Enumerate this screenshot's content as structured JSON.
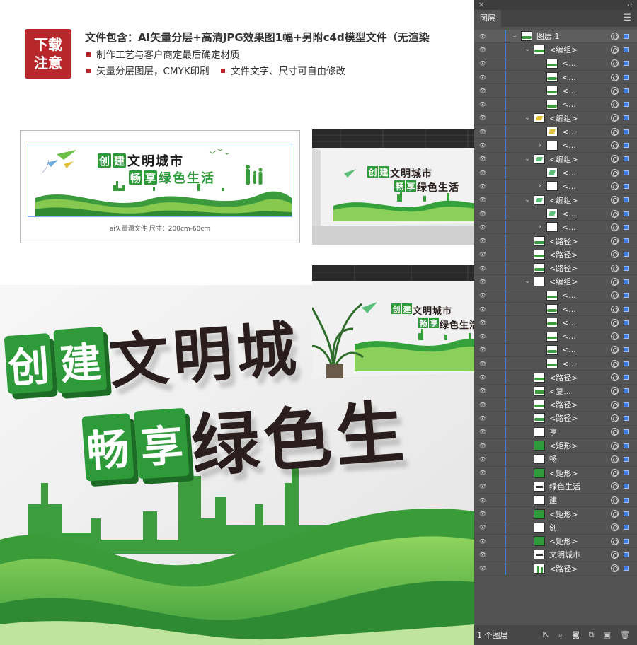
{
  "badge": {
    "line1": "下载",
    "line2": "注意"
  },
  "info": {
    "line1": "文件包含：AI矢量分层+高清JPG效果图1幅+另附c4d模型文件（无渲染",
    "bullet1": "制作工艺与客户商定最后确定材质",
    "bullet2": "矢量分层图层，CMYK印刷",
    "bullet3": "文件文字、尺寸可自由修改"
  },
  "artwork": {
    "chars_line1": [
      "创",
      "建",
      "文",
      "明",
      "城",
      "市"
    ],
    "chars_line2": [
      "畅",
      "享",
      "绿",
      "色",
      "生",
      "活"
    ],
    "caption": "ai矢量源文件    尺寸：200cm-60cm"
  },
  "colors": {
    "brand_red": "#b8272c",
    "green": "#2e9a3a",
    "light_green": "#7cc44a",
    "panel_bg": "#535353",
    "select_blue": "#3b7de0"
  },
  "layers_panel": {
    "tab": "图层",
    "footer": "1 个图层",
    "rows": [
      {
        "name": "图层 1",
        "indent": 0,
        "twirl": "open",
        "eye": true,
        "thumb": "scene"
      },
      {
        "name": "<编组>",
        "indent": 1,
        "twirl": "open",
        "eye": true,
        "thumb": "wave"
      },
      {
        "name": "<...",
        "indent": 2,
        "twirl": "",
        "eye": true,
        "thumb": "wave"
      },
      {
        "name": "<...",
        "indent": 2,
        "twirl": "",
        "eye": true,
        "thumb": "wave"
      },
      {
        "name": "<...",
        "indent": 2,
        "twirl": "",
        "eye": true,
        "thumb": "wave"
      },
      {
        "name": "<...",
        "indent": 2,
        "twirl": "",
        "eye": true,
        "thumb": "wave"
      },
      {
        "name": "<编组>",
        "indent": 1,
        "twirl": "open",
        "eye": true,
        "thumb": "yellow"
      },
      {
        "name": "<...",
        "indent": 2,
        "twirl": "",
        "eye": true,
        "thumb": "yellow"
      },
      {
        "name": "<...",
        "indent": 2,
        "twirl": "closed",
        "eye": true,
        "thumb": "blank"
      },
      {
        "name": "<编组>",
        "indent": 1,
        "twirl": "open",
        "eye": true,
        "thumb": "plane"
      },
      {
        "name": "<...",
        "indent": 2,
        "twirl": "",
        "eye": true,
        "thumb": "plane"
      },
      {
        "name": "<...",
        "indent": 2,
        "twirl": "closed",
        "eye": true,
        "thumb": "blank"
      },
      {
        "name": "<编组>",
        "indent": 1,
        "twirl": "open",
        "eye": true,
        "thumb": "plane"
      },
      {
        "name": "<...",
        "indent": 2,
        "twirl": "",
        "eye": true,
        "thumb": "plane"
      },
      {
        "name": "<...",
        "indent": 2,
        "twirl": "closed",
        "eye": true,
        "thumb": "blank"
      },
      {
        "name": "<路径>",
        "indent": 1,
        "twirl": "",
        "eye": true,
        "thumb": "wave"
      },
      {
        "name": "<路径>",
        "indent": 1,
        "twirl": "",
        "eye": true,
        "thumb": "wave"
      },
      {
        "name": "<路径>",
        "indent": 1,
        "twirl": "",
        "eye": true,
        "thumb": "wave"
      },
      {
        "name": "<编组>",
        "indent": 1,
        "twirl": "open",
        "eye": true,
        "thumb": "blank"
      },
      {
        "name": "<...",
        "indent": 2,
        "twirl": "",
        "eye": true,
        "thumb": "wave"
      },
      {
        "name": "<...",
        "indent": 2,
        "twirl": "",
        "eye": true,
        "thumb": "wave"
      },
      {
        "name": "<...",
        "indent": 2,
        "twirl": "",
        "eye": true,
        "thumb": "wave"
      },
      {
        "name": "<...",
        "indent": 2,
        "twirl": "",
        "eye": true,
        "thumb": "wave"
      },
      {
        "name": "<...",
        "indent": 2,
        "twirl": "",
        "eye": true,
        "thumb": "wave"
      },
      {
        "name": "<...",
        "indent": 2,
        "twirl": "",
        "eye": true,
        "thumb": "wave"
      },
      {
        "name": "<路径>",
        "indent": 1,
        "twirl": "",
        "eye": true,
        "thumb": "wave"
      },
      {
        "name": "<复...",
        "indent": 1,
        "twirl": "",
        "eye": true,
        "thumb": "city"
      },
      {
        "name": "<路径>",
        "indent": 1,
        "twirl": "",
        "eye": true,
        "thumb": "wave"
      },
      {
        "name": "<路径>",
        "indent": 1,
        "twirl": "",
        "eye": true,
        "thumb": "wave"
      },
      {
        "name": "享",
        "indent": 1,
        "twirl": "",
        "eye": true,
        "thumb": "blank"
      },
      {
        "name": "<矩形>",
        "indent": 1,
        "twirl": "",
        "eye": true,
        "thumb": "green"
      },
      {
        "name": "畅",
        "indent": 1,
        "twirl": "",
        "eye": true,
        "thumb": "blank"
      },
      {
        "name": "<矩形>",
        "indent": 1,
        "twirl": "",
        "eye": true,
        "thumb": "green"
      },
      {
        "name": "绿色生活",
        "indent": 1,
        "twirl": "",
        "eye": true,
        "thumb": "text"
      },
      {
        "name": "建",
        "indent": 1,
        "twirl": "",
        "eye": true,
        "thumb": "blank"
      },
      {
        "name": "<矩形>",
        "indent": 1,
        "twirl": "",
        "eye": true,
        "thumb": "green"
      },
      {
        "name": "创",
        "indent": 1,
        "twirl": "",
        "eye": true,
        "thumb": "blank"
      },
      {
        "name": "<矩形>",
        "indent": 1,
        "twirl": "",
        "eye": true,
        "thumb": "green"
      },
      {
        "name": "文明城市",
        "indent": 1,
        "twirl": "",
        "eye": true,
        "thumb": "text"
      },
      {
        "name": "<路径>",
        "indent": 1,
        "twirl": "",
        "eye": true,
        "thumb": "people"
      }
    ]
  }
}
